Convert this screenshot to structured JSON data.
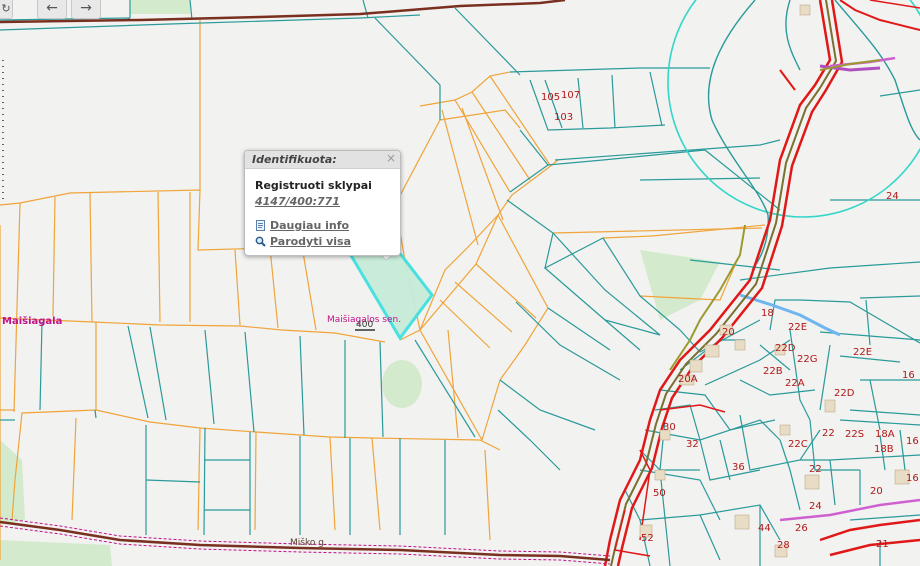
{
  "toolbar": {
    "first_glyph": "↻",
    "back_glyph": "←",
    "forward_glyph": "→"
  },
  "popup": {
    "title": "Identifikuota:",
    "close_glyph": "×",
    "layer_name": "Registruoti sklypai",
    "parcel_id": "4147/400:771",
    "more_info": "Daugiau info",
    "show_all": "Parodyti visa"
  },
  "map": {
    "place_labels": {
      "village": "Maišiagala",
      "eldership": "Maišiagalos sen.",
      "road": "Miško g."
    },
    "parcel_numbers": {
      "p105": "105",
      "p107": "107",
      "p103": "103",
      "p24": "24",
      "p400": "400",
      "p18": "18",
      "p20": "20",
      "p22e": "22E",
      "p22d": "22D",
      "p22g": "22G",
      "p22e2": "22E",
      "p22b": "22B",
      "p22a": "22A",
      "p22d2": "22D",
      "p16": "16",
      "p30": "30",
      "p32": "32",
      "p36": "36",
      "p22c": "22C",
      "p22": "22",
      "p22s": "22S",
      "p18a": "18A",
      "p18b": "18B",
      "p16b": "16",
      "p16c": "16",
      "p20b": "20",
      "p50": "50",
      "p24b": "24",
      "p44": "44",
      "p26": "26",
      "p52": "52",
      "p28": "28",
      "p21": "21",
      "p20a": "20A"
    },
    "colors": {
      "background": "#f2f2f0",
      "parcel_teal": "#2a9a9a",
      "parcel_orange": "#f0a43a",
      "highlight": "#3fe0e0",
      "road_red": "#e01818",
      "road_dark": "#7a3020",
      "green": "#d3ebcc",
      "label_red": "#b01818",
      "label_magenta": "#c0108a",
      "circle": "#33d6c8"
    }
  }
}
